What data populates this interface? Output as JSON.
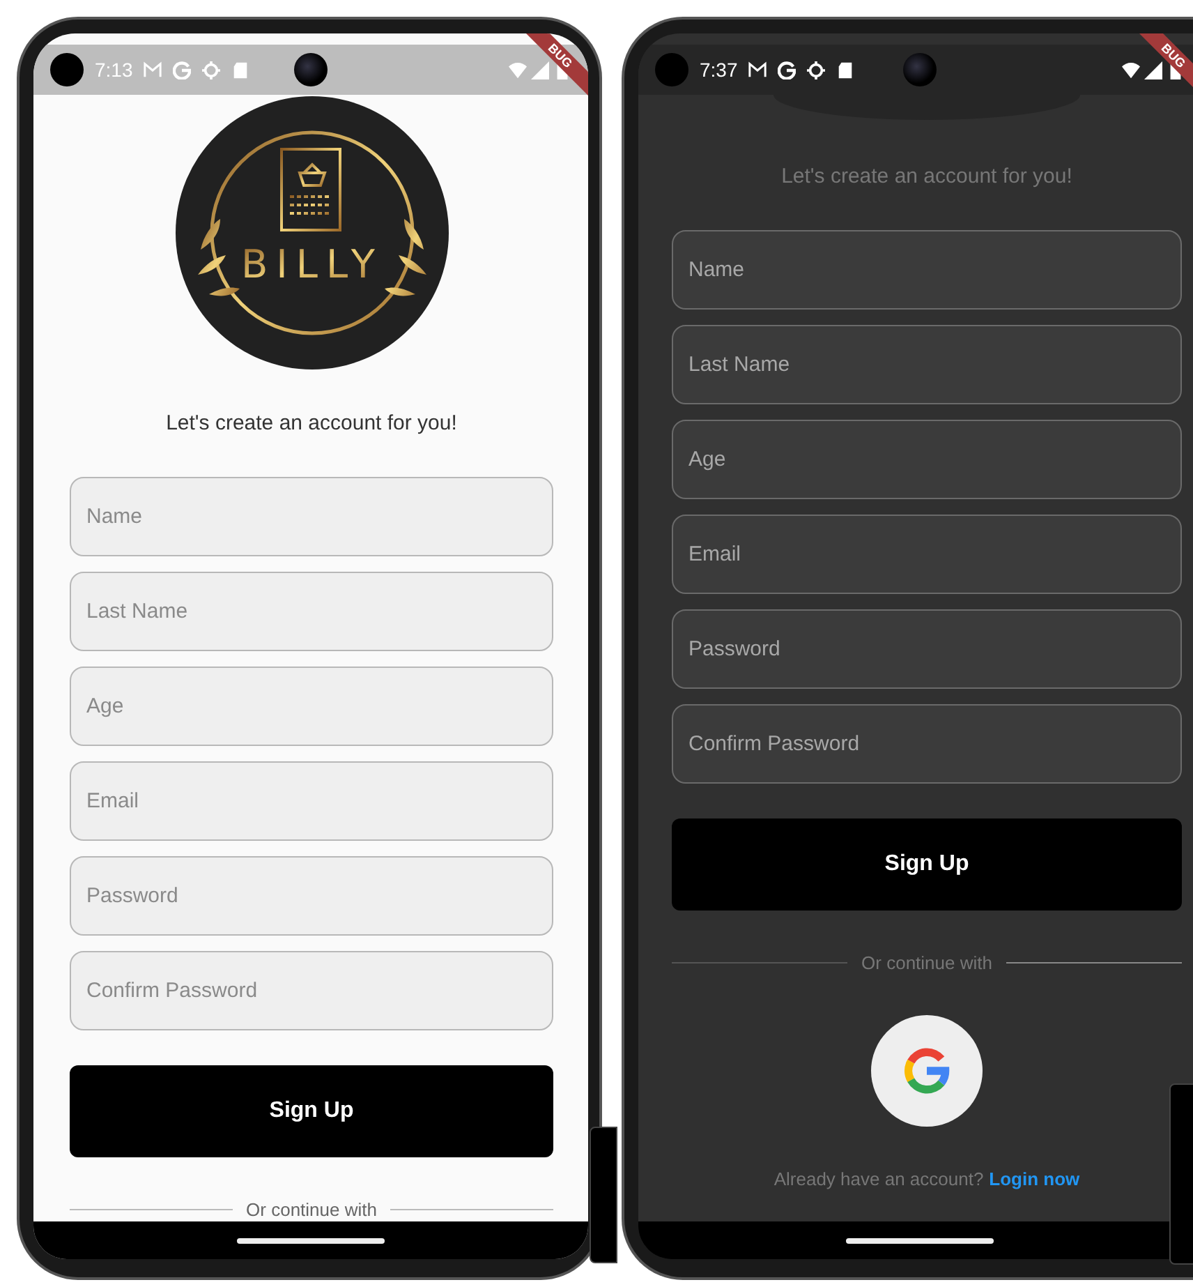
{
  "phones": [
    {
      "kind": "light",
      "status_bar": {
        "time": "7:13"
      },
      "debug_banner": "BUG",
      "logo": {
        "kind": "full",
        "text": "BILLY"
      },
      "subtitle": "Let's create an account for you!",
      "fields": [
        {
          "placeholder": "Name"
        },
        {
          "placeholder": "Last Name"
        },
        {
          "placeholder": "Age"
        },
        {
          "placeholder": "Email"
        },
        {
          "placeholder": "Password"
        },
        {
          "placeholder": "Confirm Password"
        }
      ],
      "button": "Sign Up",
      "divider_text": "Or continue with"
    },
    {
      "kind": "dark",
      "status_bar": {
        "time": "7:37"
      },
      "debug_banner": "BUG",
      "logo": {
        "kind": "cut"
      },
      "subtitle": "Let's create an account for you!",
      "fields": [
        {
          "placeholder": "Name"
        },
        {
          "placeholder": "Last Name"
        },
        {
          "placeholder": "Age"
        },
        {
          "placeholder": "Email"
        },
        {
          "placeholder": "Password"
        },
        {
          "placeholder": "Confirm Password"
        }
      ],
      "button": "Sign Up",
      "divider_text": "Or continue with",
      "google_button": true,
      "login_prompt": {
        "text": "Already have an account?",
        "link": "Login now"
      }
    }
  ]
}
